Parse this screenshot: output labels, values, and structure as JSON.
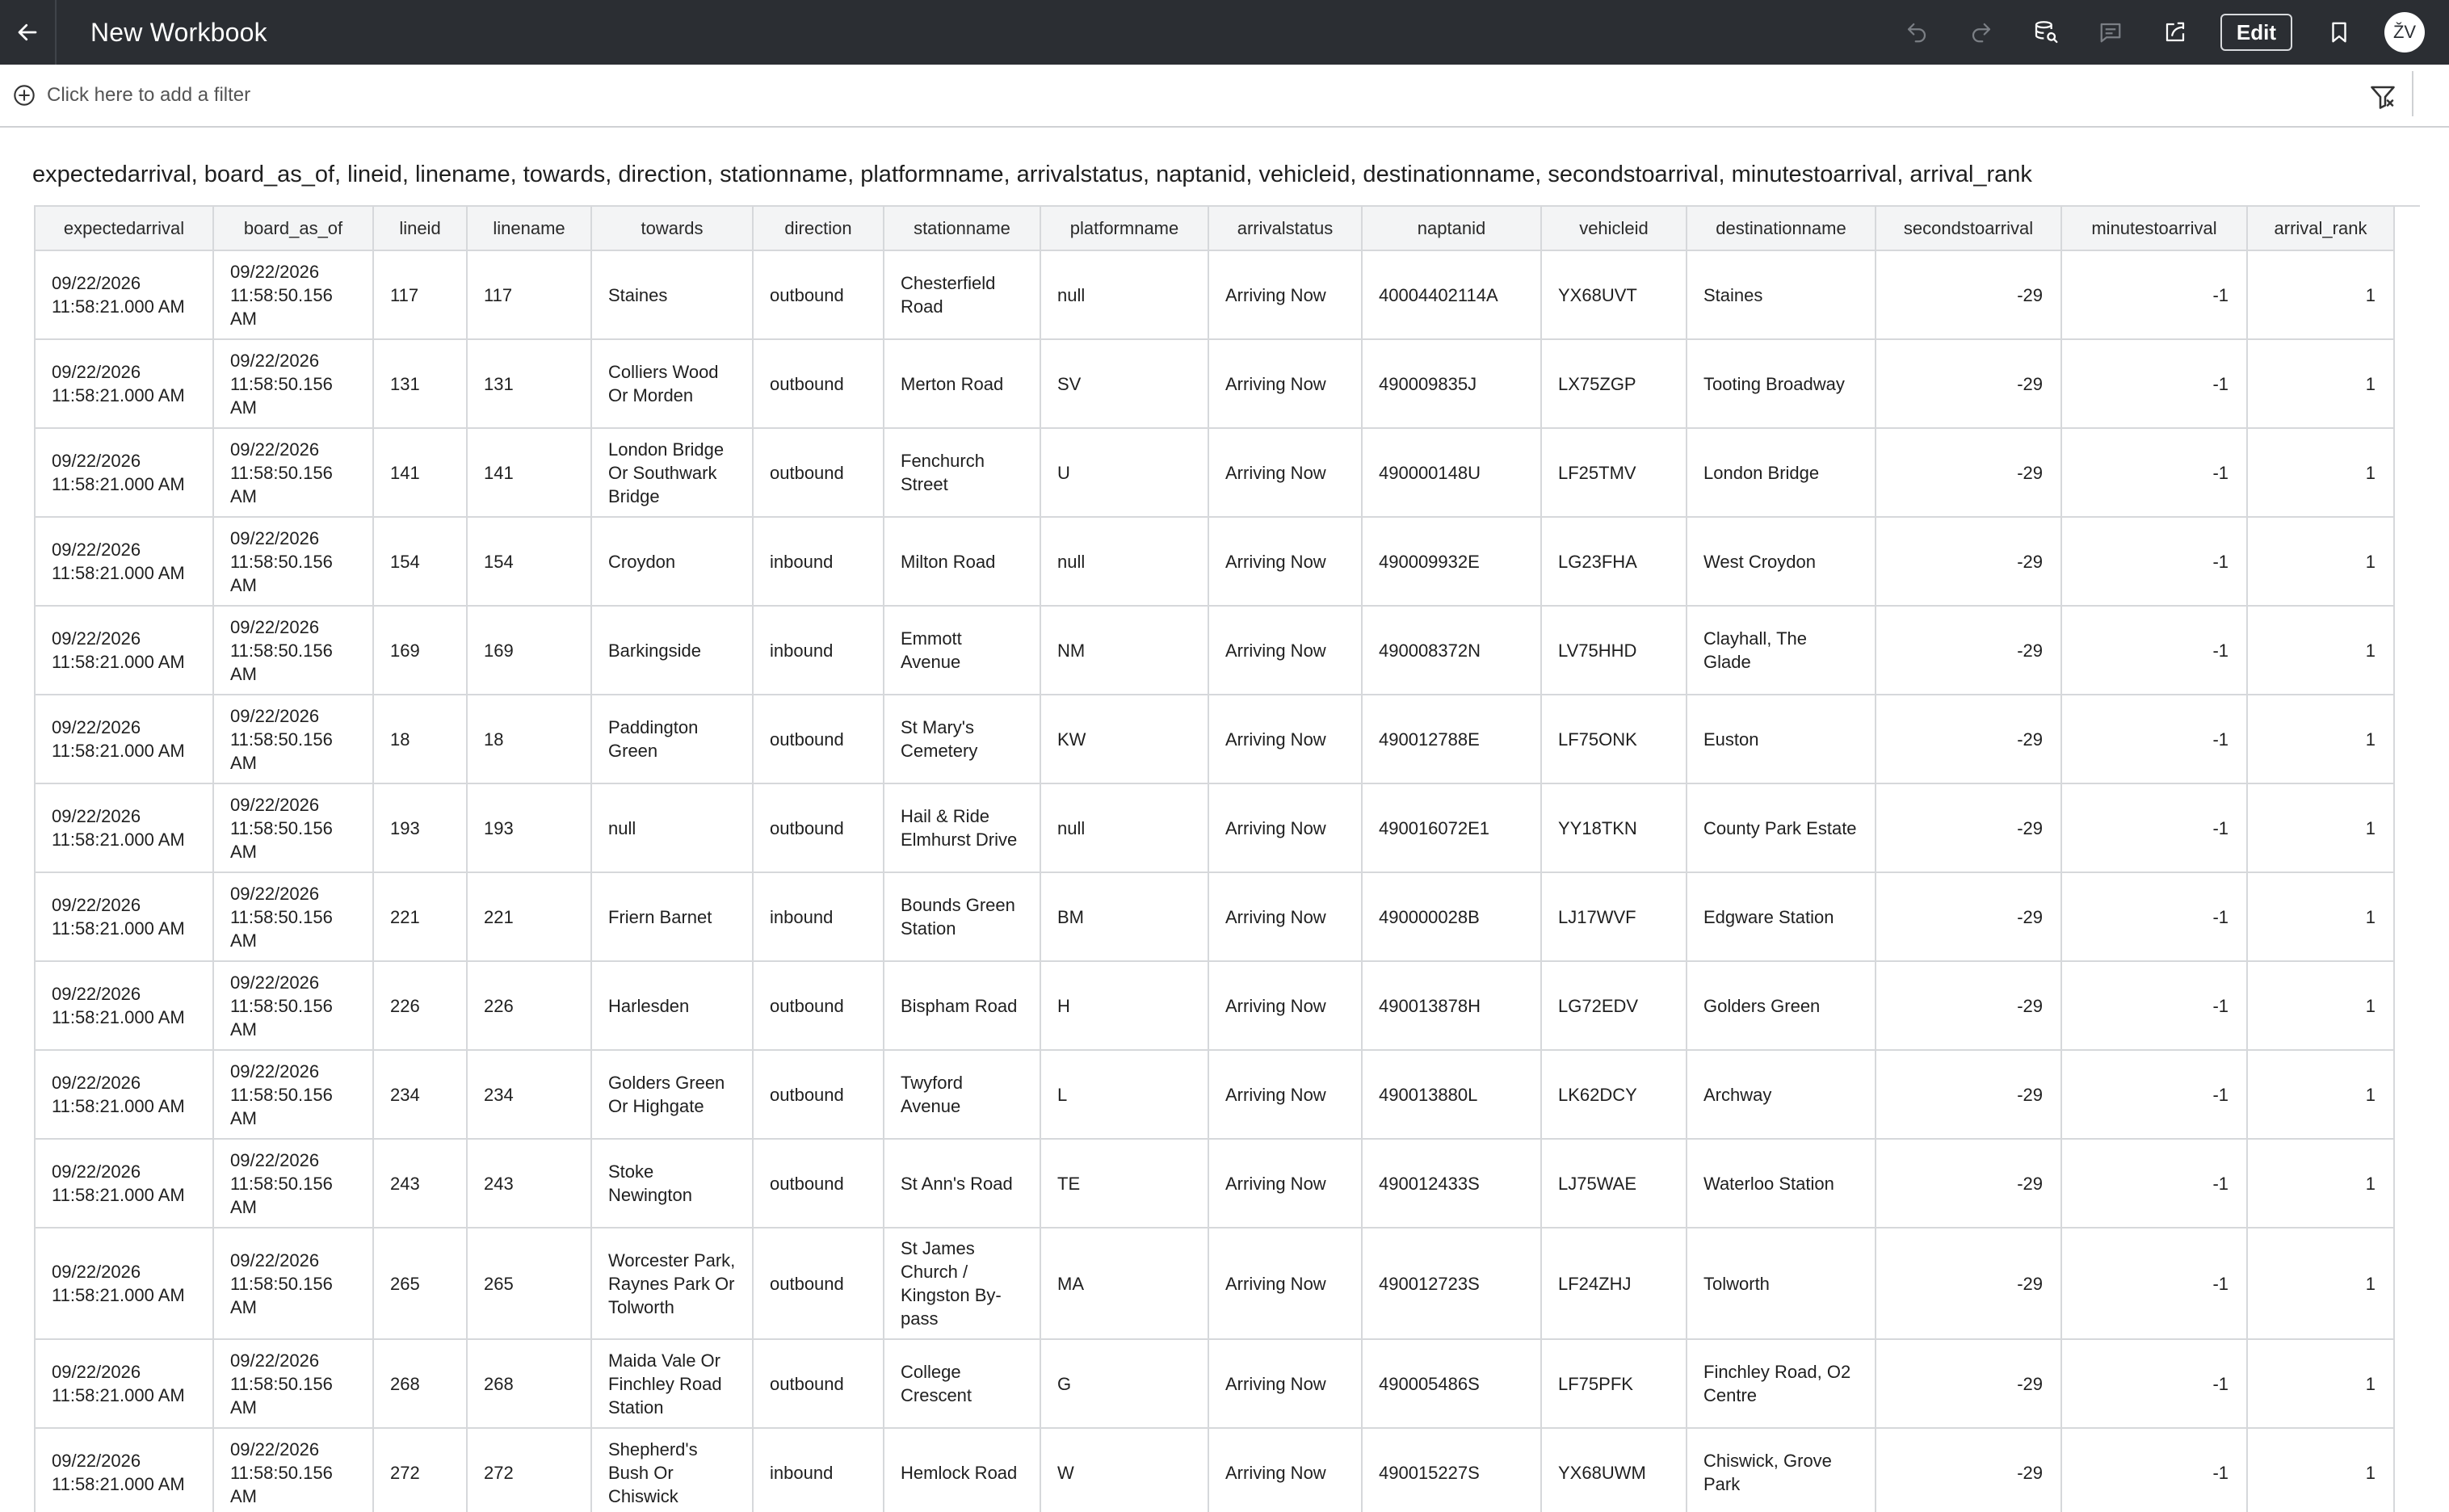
{
  "app": {
    "title": "New Workbook",
    "edit_label": "Edit",
    "user_initials": "ŽV"
  },
  "filterbar": {
    "add_filter_label": "Click here to add a filter"
  },
  "viz": {
    "title": "expectedarrival, board_as_of, lineid, linename, towards, direction, stationname, platformname, arrivalstatus, naptanid, vehicleid, destinationname, secondstoarrival, minutestoarrival, arrival_rank"
  },
  "table": {
    "columns": [
      "expectedarrival",
      "board_as_of",
      "lineid",
      "linename",
      "towards",
      "direction",
      "stationname",
      "platformname",
      "arrivalstatus",
      "naptanid",
      "vehicleid",
      "destinationname",
      "secondstoarrival",
      "minutestoarrival",
      "arrival_rank"
    ],
    "rows": [
      [
        "09/22/2026 11:58:21.000 AM",
        "09/22/2026 11:58:50.156 AM",
        "117",
        "117",
        "Staines",
        "outbound",
        "Chesterfield Road",
        "null",
        "Arriving Now",
        "40004402114A",
        "YX68UVT",
        "Staines",
        "-29",
        "-1",
        "1"
      ],
      [
        "09/22/2026 11:58:21.000 AM",
        "09/22/2026 11:58:50.156 AM",
        "131",
        "131",
        "Colliers Wood Or Morden",
        "outbound",
        "Merton Road",
        "SV",
        "Arriving Now",
        "490009835J",
        "LX75ZGP",
        "Tooting Broadway",
        "-29",
        "-1",
        "1"
      ],
      [
        "09/22/2026 11:58:21.000 AM",
        "09/22/2026 11:58:50.156 AM",
        "141",
        "141",
        "London Bridge Or Southwark Bridge",
        "outbound",
        "Fenchurch Street",
        "U",
        "Arriving Now",
        "490000148U",
        "LF25TMV",
        "London Bridge",
        "-29",
        "-1",
        "1"
      ],
      [
        "09/22/2026 11:58:21.000 AM",
        "09/22/2026 11:58:50.156 AM",
        "154",
        "154",
        "Croydon",
        "inbound",
        "Milton Road",
        "null",
        "Arriving Now",
        "490009932E",
        "LG23FHA",
        "West Croydon",
        "-29",
        "-1",
        "1"
      ],
      [
        "09/22/2026 11:58:21.000 AM",
        "09/22/2026 11:58:50.156 AM",
        "169",
        "169",
        "Barkingside",
        "inbound",
        "Emmott Avenue",
        "NM",
        "Arriving Now",
        "490008372N",
        "LV75HHD",
        "Clayhall, The Glade",
        "-29",
        "-1",
        "1"
      ],
      [
        "09/22/2026 11:58:21.000 AM",
        "09/22/2026 11:58:50.156 AM",
        "18",
        "18",
        "Paddington Green",
        "outbound",
        "St Mary's Cemetery",
        "KW",
        "Arriving Now",
        "490012788E",
        "LF75ONK",
        "Euston",
        "-29",
        "-1",
        "1"
      ],
      [
        "09/22/2026 11:58:21.000 AM",
        "09/22/2026 11:58:50.156 AM",
        "193",
        "193",
        "null",
        "outbound",
        "Hail & Ride Elmhurst Drive",
        "null",
        "Arriving Now",
        "490016072E1",
        "YY18TKN",
        "County Park Estate",
        "-29",
        "-1",
        "1"
      ],
      [
        "09/22/2026 11:58:21.000 AM",
        "09/22/2026 11:58:50.156 AM",
        "221",
        "221",
        "Friern Barnet",
        "inbound",
        "Bounds Green Station",
        "BM",
        "Arriving Now",
        "490000028B",
        "LJ17WVF",
        "Edgware Station",
        "-29",
        "-1",
        "1"
      ],
      [
        "09/22/2026 11:58:21.000 AM",
        "09/22/2026 11:58:50.156 AM",
        "226",
        "226",
        "Harlesden",
        "outbound",
        "Bispham Road",
        "H",
        "Arriving Now",
        "490013878H",
        "LG72EDV",
        "Golders Green",
        "-29",
        "-1",
        "1"
      ],
      [
        "09/22/2026 11:58:21.000 AM",
        "09/22/2026 11:58:50.156 AM",
        "234",
        "234",
        "Golders Green Or Highgate",
        "outbound",
        "Twyford Avenue",
        "L",
        "Arriving Now",
        "490013880L",
        "LK62DCY",
        "Archway",
        "-29",
        "-1",
        "1"
      ],
      [
        "09/22/2026 11:58:21.000 AM",
        "09/22/2026 11:58:50.156 AM",
        "243",
        "243",
        "Stoke Newington",
        "outbound",
        "St Ann's Road",
        "TE",
        "Arriving Now",
        "490012433S",
        "LJ75WAE",
        "Waterloo Station",
        "-29",
        "-1",
        "1"
      ],
      [
        "09/22/2026 11:58:21.000 AM",
        "09/22/2026 11:58:50.156 AM",
        "265",
        "265",
        "Worcester Park, Raynes Park Or Tolworth",
        "outbound",
        "St James Church / Kingston By-pass",
        "MA",
        "Arriving Now",
        "490012723S",
        "LF24ZHJ",
        "Tolworth",
        "-29",
        "-1",
        "1"
      ],
      [
        "09/22/2026 11:58:21.000 AM",
        "09/22/2026 11:58:50.156 AM",
        "268",
        "268",
        "Maida Vale Or Finchley Road Station",
        "outbound",
        "College Crescent",
        "G",
        "Arriving Now",
        "490005486S",
        "LF75PFK",
        "Finchley Road, O2 Centre",
        "-29",
        "-1",
        "1"
      ],
      [
        "09/22/2026 11:58:21.000 AM",
        "09/22/2026 11:58:50.156 AM",
        "272",
        "272",
        "Shepherd's Bush Or Chiswick",
        "inbound",
        "Hemlock Road",
        "W",
        "Arriving Now",
        "490015227S",
        "YX68UWM",
        "Chiswick, Grove Park",
        "-29",
        "-1",
        "1"
      ]
    ]
  }
}
